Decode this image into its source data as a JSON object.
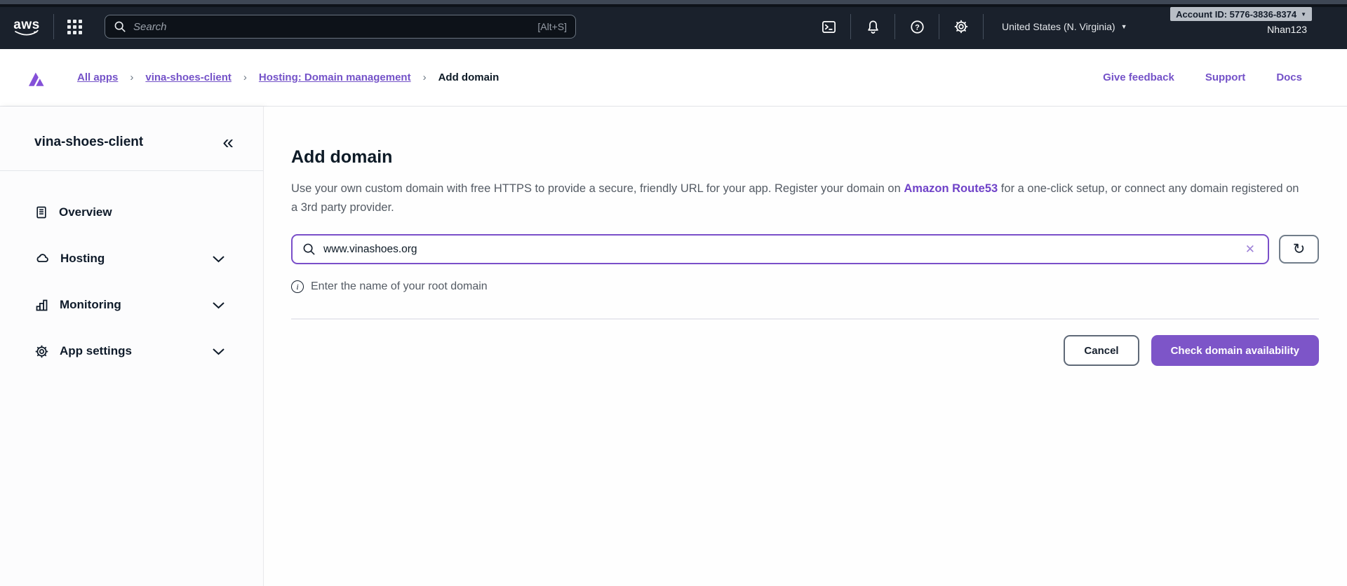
{
  "topnav": {
    "logo_text": "aws",
    "search_placeholder": "Search",
    "search_shortcut": "[Alt+S]",
    "icons": [
      "cloudshell-icon",
      "notifications-icon",
      "help-icon",
      "settings-icon"
    ],
    "region_label": "United States (N. Virginia)",
    "account_badge": "Account ID: 5776-3836-8374",
    "username": "Nhan123"
  },
  "breadcrumb": {
    "items": [
      "All apps",
      "vina-shoes-client",
      "Hosting: Domain management",
      "Add domain"
    ],
    "actions": [
      "Give feedback",
      "Support",
      "Docs"
    ]
  },
  "sidebar": {
    "app_name": "vina-shoes-client",
    "collapse_icon": "double-chevron-left",
    "items": [
      {
        "label": "Overview",
        "icon": "document-icon",
        "expandable": false
      },
      {
        "label": "Hosting",
        "icon": "cloud-icon",
        "expandable": true
      },
      {
        "label": "Monitoring",
        "icon": "bar-chart-icon",
        "expandable": true
      },
      {
        "label": "App settings",
        "icon": "gear-icon",
        "expandable": true
      }
    ]
  },
  "main": {
    "title": "Add domain",
    "intro_before_link": "Use your own custom domain with free HTTPS to provide a secure, friendly URL for your app. Register your domain on ",
    "intro_link": "Amazon Route53",
    "intro_after_link": " for a one-click setup, or connect any domain registered on a 3rd party provider.",
    "domain_value": "www.vinashoes.org",
    "helper_text": "Enter the name of your root domain",
    "cancel_label": "Cancel",
    "submit_label": "Check domain availability"
  },
  "colors": {
    "accent_purple": "#7d55c8",
    "link_purple": "#7452c8",
    "nav_background": "#1a212c",
    "top_strip": "#3e4755",
    "badge_background": "#b8bec6"
  }
}
